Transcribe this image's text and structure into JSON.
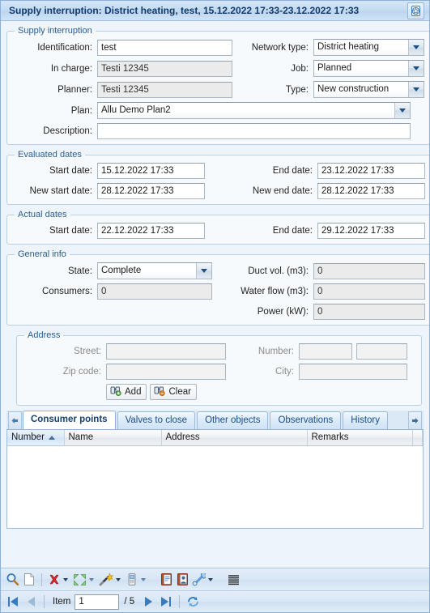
{
  "window": {
    "title": "Supply interruption: District heating, test, 15.12.2022 17:33-23.12.2022 17:33",
    "title_icon": "star-badge-icon"
  },
  "supply_interruption": {
    "legend": "Supply interruption",
    "identification_label": "Identification:",
    "identification_value": "test",
    "in_charge_label": "In charge:",
    "in_charge_value": "Testi 12345",
    "planner_label": "Planner:",
    "planner_value": "Testi 12345",
    "plan_label": "Plan:",
    "plan_value": "Allu Demo Plan2",
    "description_label": "Description:",
    "description_value": "",
    "network_type_label": "Network type:",
    "network_type_value": "District heating",
    "job_label": "Job:",
    "job_value": "Planned",
    "type_label": "Type:",
    "type_value": "New construction"
  },
  "evaluated_dates": {
    "legend": "Evaluated dates",
    "start_date_label": "Start date:",
    "start_date_value": "15.12.2022 17:33",
    "end_date_label": "End date:",
    "end_date_value": "23.12.2022 17:33",
    "new_start_date_label": "New start date:",
    "new_start_date_value": "28.12.2022 17:33",
    "new_end_date_label": "New end date:",
    "new_end_date_value": "28.12.2022 17:33"
  },
  "actual_dates": {
    "legend": "Actual dates",
    "start_date_label": "Start date:",
    "start_date_value": "22.12.2022 17:33",
    "end_date_label": "End date:",
    "end_date_value": "29.12.2022 17:33"
  },
  "general_info": {
    "legend": "General info",
    "state_label": "State:",
    "state_value": "Complete",
    "consumers_label": "Consumers:",
    "consumers_value": "0",
    "duct_vol_label": "Duct vol. (m3):",
    "duct_vol_value": "0",
    "water_flow_label": "Water flow (m3):",
    "water_flow_value": "0",
    "power_label": "Power (kW):",
    "power_value": "0"
  },
  "address": {
    "legend": "Address",
    "street_label": "Street:",
    "street_value": "",
    "zip_label": "Zip code:",
    "zip_value": "",
    "number_label": "Number:",
    "number_value": "",
    "number_extra_value": "",
    "city_label": "City:",
    "city_value": "",
    "add_button": "Add",
    "clear_button": "Clear",
    "add_icon": "binoculars-add-icon",
    "clear_icon": "binoculars-remove-icon"
  },
  "tabs": {
    "scroll_left_icon": "arrow-left-icon",
    "scroll_right_icon": "arrow-right-icon",
    "items": [
      {
        "label": "Consumer points",
        "active": true
      },
      {
        "label": "Valves to close",
        "active": false
      },
      {
        "label": "Other objects",
        "active": false
      },
      {
        "label": "Observations",
        "active": false
      },
      {
        "label": "History",
        "active": false
      }
    ]
  },
  "table": {
    "columns": [
      {
        "label": "Number",
        "sorted": true,
        "sort_dir": "asc"
      },
      {
        "label": "Name",
        "sorted": false
      },
      {
        "label": "Address",
        "sorted": false
      },
      {
        "label": "Remarks",
        "sorted": false
      }
    ],
    "rows": []
  },
  "toolbar": {
    "items": [
      {
        "name": "search-icon",
        "type": "icon"
      },
      {
        "name": "new-document-icon",
        "type": "icon"
      },
      {
        "name": "separator",
        "type": "sep"
      },
      {
        "name": "delete-icon",
        "type": "icon",
        "caret": true
      },
      {
        "name": "collapse-arrows-icon",
        "type": "icon",
        "caret": true
      },
      {
        "name": "magic-wand-icon",
        "type": "icon",
        "caret": true
      },
      {
        "name": "mobile-device-icon",
        "type": "icon",
        "caret": true
      },
      {
        "name": "notebook-icon",
        "type": "icon"
      },
      {
        "name": "contact-card-icon",
        "type": "icon"
      },
      {
        "name": "wrench-icon",
        "type": "icon",
        "caret": true
      },
      {
        "name": "list-lines-icon",
        "type": "icon"
      }
    ]
  },
  "navbar": {
    "first_icon": "go-first-icon",
    "prev_icon": "go-previous-icon",
    "item_label": "Item",
    "item_value": "1",
    "total_label": "/ 5",
    "next_icon": "go-next-icon",
    "last_icon": "go-last-icon",
    "refresh_icon": "refresh-icon"
  },
  "colors": {
    "title_text": "#123a6b",
    "legend_text": "#2c5d8f",
    "accent": "#3a7bbf",
    "delete_red": "#d7282f",
    "tab_text": "#1a4e87"
  }
}
